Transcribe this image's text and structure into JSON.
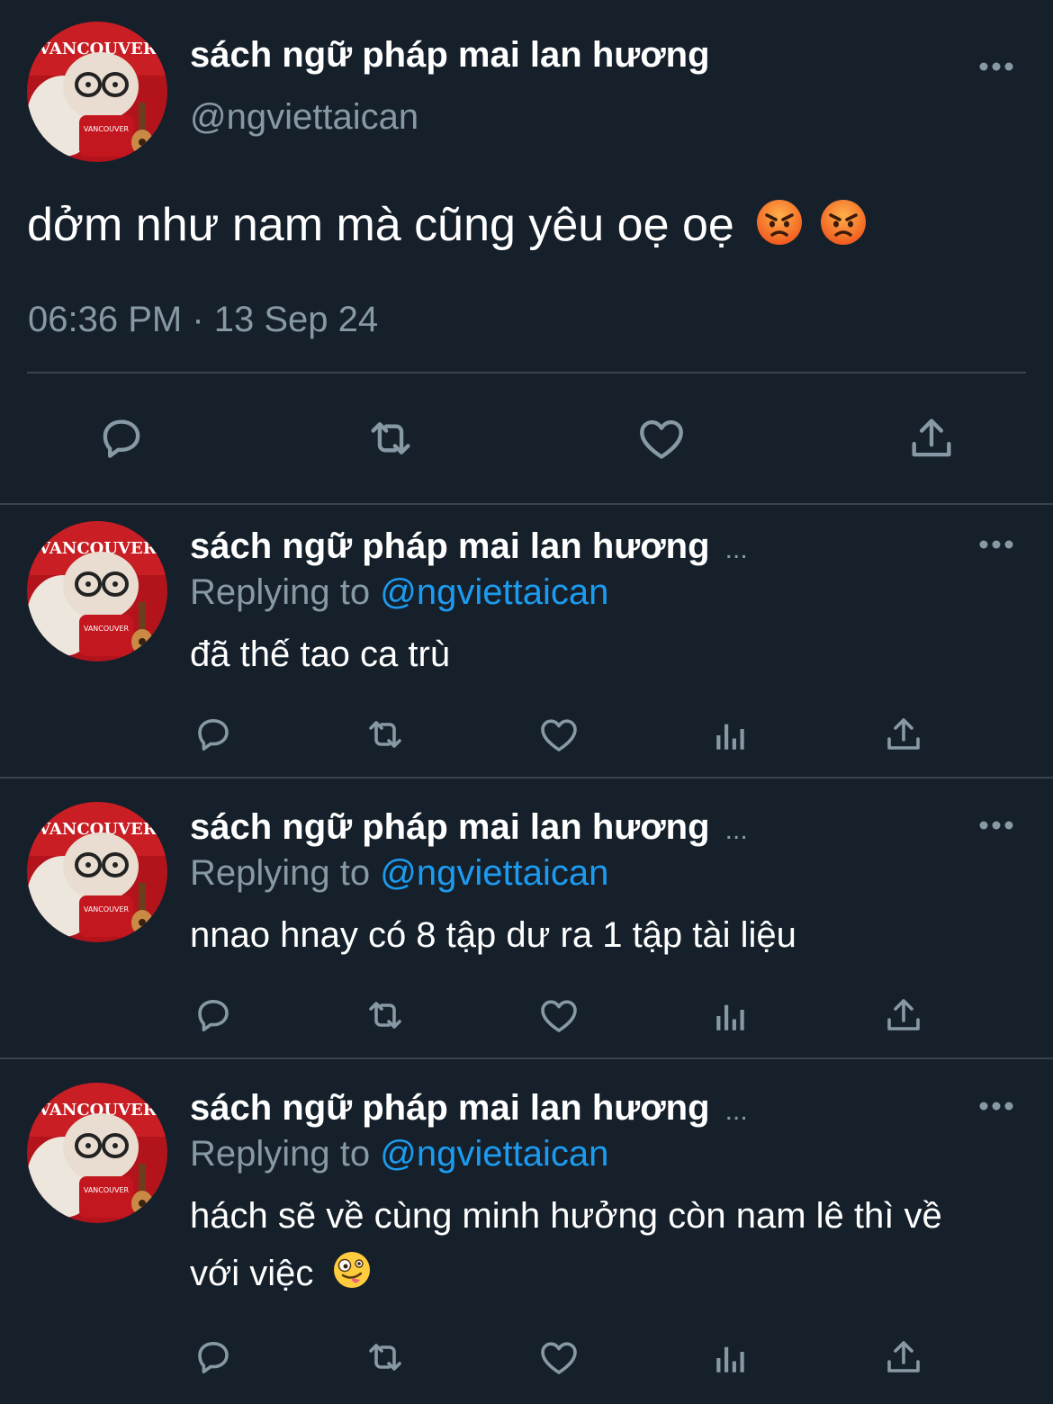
{
  "main_tweet": {
    "display_name": "sách ngữ pháp mai lan hương",
    "handle": "@ngviettaican",
    "text": "dởm như nam mà cũng yêu oẹ oẹ",
    "emojis": [
      "angry-face",
      "angry-face"
    ],
    "timestamp": "06:36 PM · 13 Sep 24"
  },
  "replies": [
    {
      "display_name": "sách ngữ pháp mai lan hương",
      "truncation": "...",
      "replying_prefix": "Replying to",
      "replying_handle": "@ngviettaican",
      "text_line1": "đã thế tao ca trù",
      "text_line2": ""
    },
    {
      "display_name": "sách ngữ pháp mai lan hương",
      "truncation": "...",
      "replying_prefix": "Replying to",
      "replying_handle": "@ngviettaican",
      "text_line1": "nnao hnay có 8 tập dư ra 1 tập tài liệu",
      "text_line2": ""
    },
    {
      "display_name": "sách ngữ pháp mai lan hương",
      "truncation": "...",
      "replying_prefix": "Replying to",
      "replying_handle": "@ngviettaican",
      "text_line1": "hách sẽ về cùng minh hưởng còn nam lê thì về",
      "text_line2": "với việc",
      "emoji": "zany-face"
    }
  ],
  "colors": {
    "background": "#15202b",
    "text": "#ffffff",
    "muted": "#8899a6",
    "link": "#1d9bf0",
    "divider": "#38444d"
  }
}
